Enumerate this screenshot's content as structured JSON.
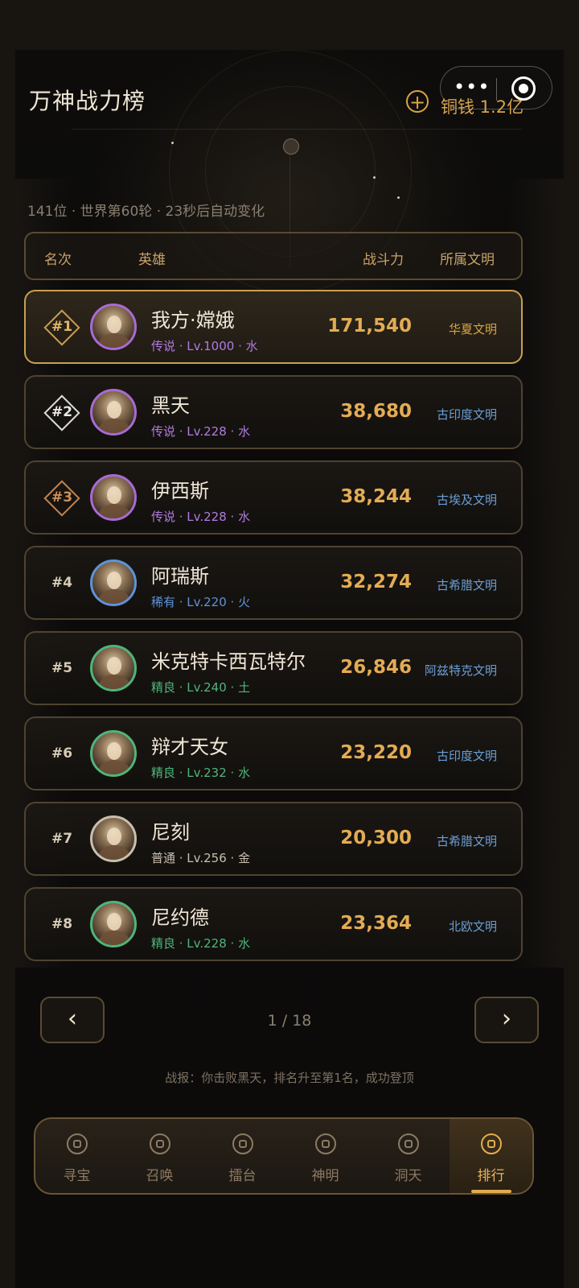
{
  "header": {
    "title": "万神战力榜",
    "currency_label": "铜钱 1.2亿",
    "sub_info": "141位 · 世界第60轮 · 23秒后自动变化"
  },
  "capsule": {
    "more_icon": "•••",
    "close_icon": "target-icon"
  },
  "table_header": {
    "rank": "名次",
    "hero": "英雄",
    "power": "战斗力",
    "civ": "所属文明"
  },
  "rows": [
    {
      "rank": "#1",
      "name": "我方·嫦娥",
      "meta": "传说 · Lv.1000 · 水",
      "power": "171,540",
      "civ": "华夏文明"
    },
    {
      "rank": "#2",
      "name": "黑天",
      "meta": "传说 · Lv.228 · 水",
      "power": "38,680",
      "civ": "古印度文明"
    },
    {
      "rank": "#3",
      "name": "伊西斯",
      "meta": "传说 · Lv.228 · 水",
      "power": "38,244",
      "civ": "古埃及文明"
    },
    {
      "rank": "#4",
      "name": "阿瑞斯",
      "meta": "稀有 · Lv.220 · 火",
      "power": "32,274",
      "civ": "古希腊文明"
    },
    {
      "rank": "#5",
      "name": "米克特卡西瓦特尔",
      "meta": "精良 · Lv.240 · 土",
      "power": "26,846",
      "civ": "阿兹特克文明"
    },
    {
      "rank": "#6",
      "name": "辩才天女",
      "meta": "精良 · Lv.232 · 水",
      "power": "23,220",
      "civ": "古印度文明"
    },
    {
      "rank": "#7",
      "name": "尼刻",
      "meta": "普通 · Lv.256 · 金",
      "power": "20,300",
      "civ": "古希腊文明"
    },
    {
      "rank": "#8",
      "name": "尼约德",
      "meta": "精良 · Lv.228 · 水",
      "power": "23,364",
      "civ": "北欧文明"
    }
  ],
  "pager": {
    "prev": "‹",
    "next": "›",
    "text": "1 / 18"
  },
  "battle_report": "战报：你击败黑天，排名升至第1名，成功登顶",
  "nav": [
    {
      "label": "寻宝",
      "icon": "treasure-icon"
    },
    {
      "label": "召唤",
      "icon": "summon-icon"
    },
    {
      "label": "擂台",
      "icon": "arena-icon"
    },
    {
      "label": "神明",
      "icon": "gods-icon"
    },
    {
      "label": "洞天",
      "icon": "cave-icon"
    },
    {
      "label": "排行",
      "icon": "ranking-icon",
      "active": true
    }
  ],
  "colors": {
    "legend": "#b07be0",
    "rare": "#5e93d8",
    "fine": "#4fb57a",
    "common": "#c8bfb0",
    "gold": "#e3ac54",
    "civ_blue": "#6a9fd6",
    "civ_gold": "#d9a441"
  }
}
